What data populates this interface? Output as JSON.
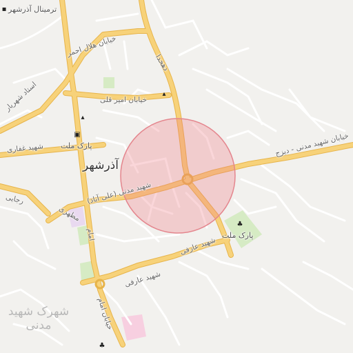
{
  "map": {
    "zoom": null,
    "colors": {
      "background": "#f2f1ee",
      "minor_road": "#ffffff",
      "major_road": "#f7d27a",
      "major_road_casing": "#e7b44a",
      "park": "#d6ebc4",
      "pink_area": "#f7cfe0",
      "circle_fill": "rgba(240,120,130,0.30)",
      "circle_stroke": "#e4858d"
    },
    "labels": {
      "terminal": "ترمینال آذرشهر",
      "helal_ahmar": "خیابان هلال احمر",
      "ostad_shahriar": "استاد شهریار",
      "dehkhoda": "دهخدا",
      "amir_gholi": "خیابان امیر قلی",
      "park_mellat_north": "پارک ملت",
      "shahid_ghaffari": "شهید غفاری",
      "city": "آذرشهر",
      "madani_ali_abad": "شهید مدنی (علی آباد)",
      "madani_dizaj": "خیابان شهید مدنی - دیزج",
      "rajaei": "رجایی",
      "motahari": "مطهری",
      "imam": "امام",
      "park_mellat": "پارک ملت",
      "aref_1": "شهید عارفی",
      "aref_2": "شهید عارفی",
      "imam_street": "خیابان امام",
      "shahrak_madani": "شهرک شهید مدنی"
    },
    "pois": [
      {
        "icon": "bus-terminal-icon",
        "glyph": "▪"
      },
      {
        "icon": "mosque-icon",
        "glyph": "▴"
      },
      {
        "icon": "mosque-icon",
        "glyph": "▴"
      },
      {
        "icon": "bus-stop-icon",
        "glyph": "▣"
      },
      {
        "icon": "tree-icon",
        "glyph": "♣"
      },
      {
        "icon": "tree-icon",
        "glyph": "♣"
      }
    ]
  }
}
